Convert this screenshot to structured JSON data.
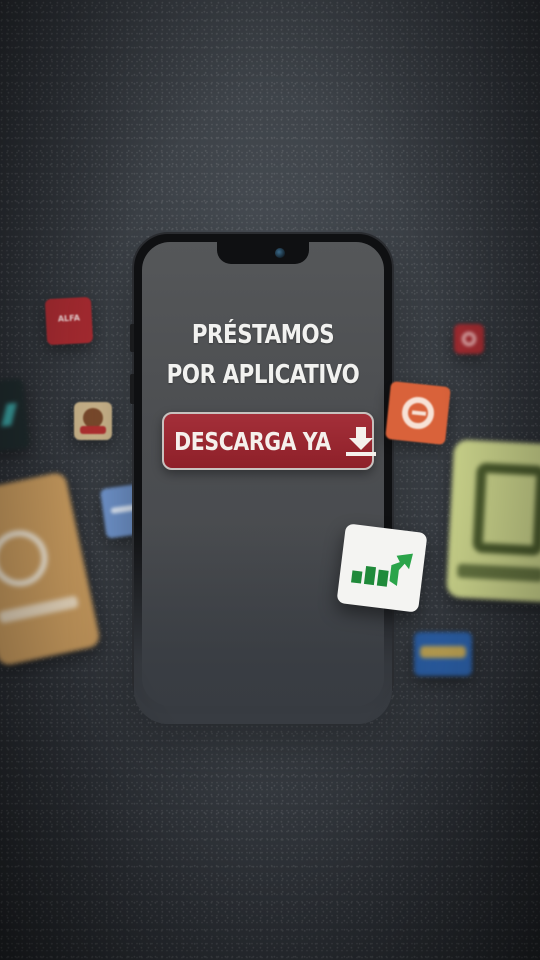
{
  "headline": {
    "line1": "PRÉSTAMOS",
    "line2": "POR APLICATIVO"
  },
  "cta": {
    "label": "DESCARGA YA",
    "icon": "download-icon"
  },
  "floating_apps": [
    {
      "name": "alfa-app-icon",
      "label": "ALFA",
      "color": "#a32a2e"
    },
    {
      "name": "cartoon-app-icon",
      "color": "#c9b38a"
    },
    {
      "name": "dark-app-icon",
      "color": "#1e2a2c"
    },
    {
      "name": "orange-app-icon",
      "color": "#c79a5e"
    },
    {
      "name": "blue-app-icon",
      "color": "#6e92c9"
    },
    {
      "name": "small-blue-app-icon",
      "color": "#3f7ec6"
    },
    {
      "name": "green-arrow-app-icon",
      "color": "#f4f4f2"
    },
    {
      "name": "red-e-app-icon",
      "color": "#d9623a"
    },
    {
      "name": "small-red-app-icon",
      "color": "#a02b30"
    },
    {
      "name": "lime-app-icon",
      "color": "#c9d28a"
    },
    {
      "name": "navy-app-icon",
      "color": "#2b5fa6"
    }
  ]
}
